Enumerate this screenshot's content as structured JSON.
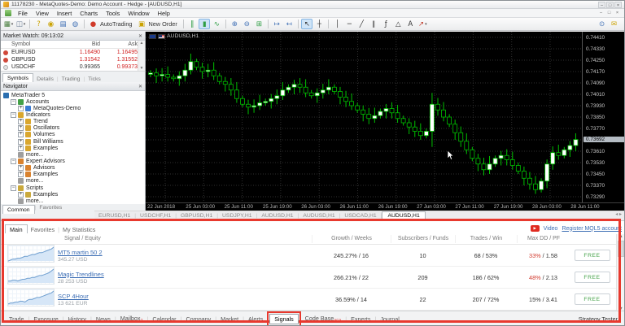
{
  "window": {
    "title": "11178230 - MetaQuotes-Demo: Demo Account - Hedge - [AUDUSD,H1]"
  },
  "menu": {
    "items": [
      "File",
      "View",
      "Insert",
      "Charts",
      "Tools",
      "Window",
      "Help"
    ]
  },
  "toolbar": {
    "groups": [
      [
        {
          "name": "new-chart",
          "dropdown": true
        },
        {
          "name": "profiles",
          "dropdown": true
        }
      ],
      [
        {
          "name": "help"
        },
        {
          "name": "market-watch"
        },
        {
          "name": "data-window"
        },
        {
          "name": "ip-status"
        }
      ],
      [
        {
          "name": "autotrading",
          "label": "AutoTrading"
        },
        {
          "name": "new-order",
          "label": "New Order"
        }
      ],
      [
        {
          "name": "bar-chart"
        },
        {
          "name": "candle-chart",
          "active": true
        },
        {
          "name": "line-chart"
        }
      ],
      [
        {
          "name": "zoom-in"
        },
        {
          "name": "zoom-out"
        },
        {
          "name": "tile-windows"
        }
      ],
      [
        {
          "name": "auto-scroll"
        },
        {
          "name": "chart-shift"
        }
      ],
      [
        {
          "name": "cursor",
          "active": true
        },
        {
          "name": "crosshair"
        }
      ],
      [
        {
          "name": "vertical-line"
        },
        {
          "name": "horizontal-line"
        },
        {
          "name": "trendline"
        },
        {
          "name": "equidistant-channel"
        },
        {
          "name": "fibonacci"
        },
        {
          "name": "shapes"
        },
        {
          "name": "text-label"
        },
        {
          "name": "arrows",
          "dropdown": true
        }
      ]
    ],
    "right": [
      {
        "name": "search"
      },
      {
        "name": "community-chat"
      }
    ]
  },
  "market_watch": {
    "title": "Market Watch: 09:13:02",
    "columns": [
      "Symbol",
      "Bid",
      "Ask"
    ],
    "rows": [
      {
        "symbol": "EURUSD",
        "bid": "1.16490",
        "ask": "1.16495",
        "bid_color": "#d02020",
        "ask_color": "#d02020",
        "dot": "#d0483a"
      },
      {
        "symbol": "GBPUSD",
        "bid": "1.31542",
        "ask": "1.31552",
        "bid_color": "#d02020",
        "ask_color": "#d02020",
        "dot": "#d0483a"
      },
      {
        "symbol": "USDCHF",
        "bid": "0.99365",
        "ask": "0.99373",
        "bid_color": "#333333",
        "ask_color": "#d02020",
        "dot": "#e3e3e3"
      }
    ],
    "tabs": [
      "Symbols",
      "Details",
      "Trading",
      "Ticks"
    ],
    "active_tab": "Symbols"
  },
  "navigator": {
    "title": "Navigator",
    "tree": [
      {
        "label": "MetaTrader 5",
        "depth": 0,
        "box": null,
        "icon": "mt5"
      },
      {
        "label": "Accounts",
        "depth": 1,
        "box": "minus",
        "icon": "accounts"
      },
      {
        "label": "MetaQuotes-Demo",
        "depth": 2,
        "box": "plus",
        "icon": "account"
      },
      {
        "label": "Indicators",
        "depth": 1,
        "box": "minus",
        "icon": "indicators"
      },
      {
        "label": "Trend",
        "depth": 2,
        "box": "plus",
        "icon": "indicator-folder"
      },
      {
        "label": "Oscillators",
        "depth": 2,
        "box": "plus",
        "icon": "indicator-folder"
      },
      {
        "label": "Volumes",
        "depth": 2,
        "box": "plus",
        "icon": "indicator-folder"
      },
      {
        "label": "Bill Williams",
        "depth": 2,
        "box": "plus",
        "icon": "indicator-folder"
      },
      {
        "label": "Examples",
        "depth": 2,
        "box": "plus",
        "icon": "examples-folder"
      },
      {
        "label": "more...",
        "depth": 2,
        "box": null,
        "icon": "more"
      },
      {
        "label": "Expert Advisors",
        "depth": 1,
        "box": "minus",
        "icon": "experts"
      },
      {
        "label": "Advisors",
        "depth": 2,
        "box": "plus",
        "icon": "expert"
      },
      {
        "label": "Examples",
        "depth": 2,
        "box": "plus",
        "icon": "expert"
      },
      {
        "label": "more...",
        "depth": 2,
        "box": null,
        "icon": "more"
      },
      {
        "label": "Scripts",
        "depth": 1,
        "box": "minus",
        "icon": "scripts"
      },
      {
        "label": "Examples",
        "depth": 2,
        "box": "plus",
        "icon": "script"
      },
      {
        "label": "more...",
        "depth": 2,
        "box": null,
        "icon": "more"
      }
    ],
    "tabs": [
      "Common",
      "Favorites"
    ],
    "active_tab": "Common"
  },
  "chart": {
    "symbol_label": "AUDUSD,H1",
    "current_price": "0.73692",
    "price_axis": [
      0.7441,
      0.7433,
      0.7425,
      0.7417,
      0.7409,
      0.7401,
      0.7393,
      0.7385,
      0.7377,
      0.7369,
      0.7361,
      0.7353,
      0.7345,
      0.7337,
      0.7329
    ],
    "skip_label_value": 0.7369,
    "time_axis": [
      "22 Jun 2018",
      "25 Jun 03:00",
      "25 Jun 11:00",
      "25 Jun 19:00",
      "26 Jun 03:00",
      "26 Jun 11:00",
      "26 Jun 19:00",
      "27 Jun 03:00",
      "27 Jun 11:00",
      "27 Jun 19:00",
      "28 Jun 03:00",
      "28 Jun 11:00"
    ]
  },
  "chart_tabs": {
    "items": [
      "EURUSD,H1",
      "USDCHF,H1",
      "GBPUSD,H1",
      "USDJPY,H1",
      "AUDUSD,H1",
      "AUDUSD,H1",
      "USDCAD,H1",
      "AUDUSD,H1"
    ],
    "active_index": 7
  },
  "signals": {
    "tabs": [
      "Main",
      "Favorites",
      "My Statistics"
    ],
    "active_tab": "Main",
    "video_link": "Video",
    "register_link": "Register MQL5 account",
    "columns": [
      "Signal / Equity",
      "Growth / Weeks",
      "Subscribers / Funds",
      "Trades / Win",
      "Max DD / PF"
    ],
    "free_label": "FREE",
    "rows": [
      {
        "name": "MT5 martin 50 2",
        "equity": "345.27 USD",
        "growth": "245.27% / 16",
        "subscribers": "10",
        "trades": "68 / 53%",
        "maxdd": "33%",
        "maxdd_red": true,
        "pf": " / 1.58",
        "spark": [
          0,
          1,
          2,
          2,
          3,
          3,
          4,
          5,
          5,
          6,
          7,
          7,
          8,
          9,
          9,
          10,
          11,
          12,
          13,
          15
        ]
      },
      {
        "name": "Magic Trendlines",
        "equity": "28 253 USD",
        "growth": "266.21% / 22",
        "subscribers": "209",
        "trades": "186 / 62%",
        "maxdd": "48%",
        "maxdd_red": true,
        "pf": " / 2.13",
        "spark": [
          2,
          2,
          3,
          3,
          2,
          3,
          4,
          4,
          5,
          5,
          6,
          6,
          7,
          8,
          8,
          9,
          10,
          11,
          13,
          15
        ]
      },
      {
        "name": "SCP 4Hour",
        "equity": "13 621 EUR",
        "growth": "36.59% / 14",
        "subscribers": "22",
        "trades": "207 / 72%",
        "maxdd": "15%",
        "maxdd_red": false,
        "pf": " / 3.41",
        "spark": [
          1,
          2,
          2,
          3,
          3,
          4,
          4,
          3,
          5,
          6,
          6,
          7,
          8,
          8,
          9,
          10,
          11,
          12,
          13,
          15
        ]
      }
    ]
  },
  "bottom_bar": {
    "tabs": [
      {
        "label": "Trade"
      },
      {
        "label": "Exposure"
      },
      {
        "label": "History"
      },
      {
        "label": "News"
      },
      {
        "label": "Mailbox",
        "badge": "7"
      },
      {
        "label": "Calendar"
      },
      {
        "label": "Company"
      },
      {
        "label": "Market"
      },
      {
        "label": "Alerts"
      },
      {
        "label": "Signals",
        "active": true
      },
      {
        "label": "Code Base",
        "badge": "258"
      },
      {
        "label": "Experts"
      },
      {
        "label": "Journal"
      }
    ],
    "status_right": "Strategy Tester"
  },
  "annotations": {
    "highlight_color": "#e8392e"
  },
  "chart_data": {
    "type": "candlestick",
    "symbol": "AUDUSD",
    "timeframe": "H1",
    "price_range": [
      0.7325,
      0.7445
    ],
    "first_open": 0.7415,
    "closes": [
      0.7416,
      0.7414,
      0.7415,
      0.7413,
      0.7412,
      0.7414,
      0.7418,
      0.7424,
      0.742,
      0.7417,
      0.7418,
      0.7414,
      0.741,
      0.7408,
      0.7404,
      0.7398,
      0.7394,
      0.7392,
      0.7393,
      0.7395,
      0.7396,
      0.7398,
      0.74,
      0.7404,
      0.7406,
      0.7408,
      0.7406,
      0.7402,
      0.74,
      0.7402,
      0.7404,
      0.7406,
      0.7403,
      0.7399,
      0.7396,
      0.7393,
      0.739,
      0.7387,
      0.7384,
      0.7386,
      0.7389,
      0.7391,
      0.7388,
      0.7384,
      0.7381,
      0.7378,
      0.7375,
      0.7372,
      0.7375,
      0.7394,
      0.739,
      0.7385,
      0.738,
      0.7374,
      0.7368,
      0.7362,
      0.7356,
      0.7352,
      0.7348,
      0.7352,
      0.7356,
      0.7358,
      0.7355,
      0.7351,
      0.7347,
      0.7342,
      0.7338,
      0.7334,
      0.734,
      0.7352,
      0.736,
      0.7358,
      0.7362,
      0.7365,
      0.73692
    ],
    "spike": {
      "index": 49,
      "high": 0.7402,
      "low": 0.7364
    },
    "up_color": "#ffffff",
    "down_color": "#000000",
    "outline_color": "#00c000",
    "background": "#000000"
  }
}
